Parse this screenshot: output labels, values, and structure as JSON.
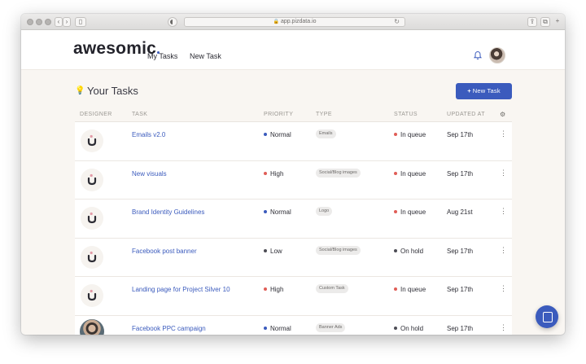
{
  "browser": {
    "url": "app.pizdata.io"
  },
  "header": {
    "logo": "awesomic",
    "nav": [
      "My Tasks",
      "New Task"
    ]
  },
  "page": {
    "title": "Your Tasks",
    "new_task_label": "New Task"
  },
  "table": {
    "columns": [
      "DESIGNER",
      "TASK",
      "PRIORITY",
      "TYPE",
      "STATUS",
      "UPDATED AT"
    ],
    "rows": [
      {
        "task": "Emails v2.0",
        "priority": "Normal",
        "type": "Emails",
        "status": "In queue",
        "updated": "Sep 17th",
        "designer_avatar": "logo"
      },
      {
        "task": "New visuals",
        "priority": "High",
        "type": "Social/Blog images",
        "status": "In queue",
        "updated": "Sep 17th",
        "designer_avatar": "logo"
      },
      {
        "task": "Brand Identity Guidelines",
        "priority": "Normal",
        "type": "Logo",
        "status": "In queue",
        "updated": "Aug 21st",
        "designer_avatar": "logo"
      },
      {
        "task": "Facebook post banner",
        "priority": "Low",
        "type": "Social/Blog images",
        "status": "On hold",
        "updated": "Sep 17th",
        "designer_avatar": "logo"
      },
      {
        "task": "Landing page for Project Silver 10",
        "priority": "High",
        "type": "Custom Task",
        "status": "In queue",
        "updated": "Sep 17th",
        "designer_avatar": "logo"
      },
      {
        "task": "Facebook PPC campaign",
        "priority": "Normal",
        "type": "Banner Ads",
        "status": "On hold",
        "updated": "Sep 17th",
        "designer_avatar": "photo"
      }
    ]
  },
  "colors": {
    "accent": "#3b5bbd",
    "priority_normal": "#3b5bbd",
    "priority_high": "#e05d57",
    "priority_low": "#4d4d55",
    "status_in_queue": "#e05d57",
    "status_on_hold": "#4d4d55"
  },
  "icons": [
    "bell-icon",
    "bulb-icon",
    "gear-icon",
    "kebab-menu-icon",
    "chat-icon"
  ]
}
